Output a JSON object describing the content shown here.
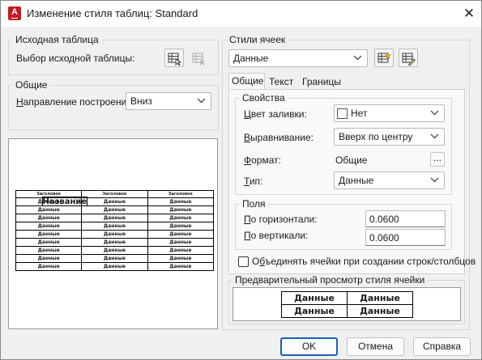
{
  "window": {
    "title": "Изменение стиля таблиц: Standard",
    "app_icon_letter": "A"
  },
  "source_table": {
    "group_label": "Исходная таблица",
    "select_label": "Выбор исходной таблицы:"
  },
  "general": {
    "group_label": "Общие",
    "direction_label": "Направление построения:",
    "direction_value": "Вниз"
  },
  "table_preview": {
    "title": "Название",
    "headers": [
      "Заголовок",
      "Заголовок",
      "Заголовок"
    ],
    "rows": [
      [
        "Данные",
        "Данные",
        "Данные"
      ],
      [
        "Данные",
        "Данные",
        "Данные"
      ],
      [
        "Данные",
        "Данные",
        "Данные"
      ],
      [
        "Данные",
        "Данные",
        "Данные"
      ],
      [
        "Данные",
        "Данные",
        "Данные"
      ],
      [
        "Данные",
        "Данные",
        "Данные"
      ],
      [
        "Данные",
        "Данные",
        "Данные"
      ],
      [
        "Данные",
        "Данные",
        "Данные"
      ],
      [
        "Данные",
        "Данные",
        "Данные"
      ]
    ]
  },
  "cell_styles": {
    "group_label": "Стили ячеек",
    "selected": "Данные",
    "tabs": [
      "Общие",
      "Текст",
      "Границы"
    ],
    "active_tab": "Общие"
  },
  "properties": {
    "group_label": "Свойства",
    "fill_label": "Цвет заливки:",
    "fill_value": "Нет",
    "align_label": "Выравнивание:",
    "align_value": "Вверх по центру",
    "format_label": "Формат:",
    "format_value": "Общие",
    "format_button": "...",
    "type_label": "Тип:",
    "type_value": "Данные"
  },
  "margins": {
    "group_label": "Поля",
    "horizontal_label": "По горизонтали:",
    "horizontal_value": "0.0600",
    "vertical_label": "По вертикали:",
    "vertical_value": "0.0600"
  },
  "merge_checkbox": {
    "label": "Объединять ячейки при создании строк/столбцов",
    "checked": false
  },
  "cell_preview": {
    "group_label": "Предварительный просмотр стиля ячейки",
    "rows": [
      [
        "Данные",
        "Данные"
      ],
      [
        "Данные",
        "Данные"
      ]
    ]
  },
  "buttons": {
    "ok": "OK",
    "cancel": "Отмена",
    "help": "Справка"
  },
  "colors": {
    "app_icon": "#c8191e",
    "default_button_border": "#1b5fb4"
  }
}
